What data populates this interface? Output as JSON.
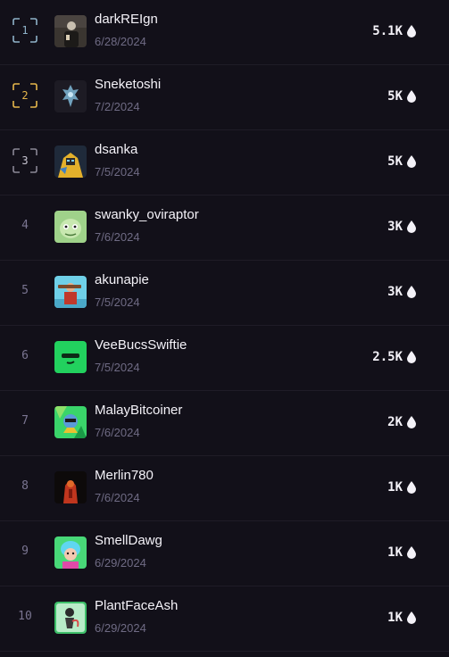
{
  "leaderboard": {
    "rows": [
      {
        "rank": "1",
        "name": "darkREIgn",
        "date": "6/28/2024",
        "amount": "5.1K",
        "icon": "drop-icon"
      },
      {
        "rank": "2",
        "name": "Sneketoshi",
        "date": "7/2/2024",
        "amount": "5K",
        "icon": "drop-icon"
      },
      {
        "rank": "3",
        "name": "dsanka",
        "date": "7/5/2024",
        "amount": "5K",
        "icon": "drop-icon"
      },
      {
        "rank": "4",
        "name": "swanky_oviraptor",
        "date": "7/6/2024",
        "amount": "3K",
        "icon": "drop-icon"
      },
      {
        "rank": "5",
        "name": "akunapie",
        "date": "7/5/2024",
        "amount": "3K",
        "icon": "drop-icon"
      },
      {
        "rank": "6",
        "name": "VeeBucsSwiftie",
        "date": "7/5/2024",
        "amount": "2.5K",
        "icon": "drop-icon"
      },
      {
        "rank": "7",
        "name": "MalayBitcoiner",
        "date": "7/6/2024",
        "amount": "2K",
        "icon": "drop-icon"
      },
      {
        "rank": "8",
        "name": "Merlin780",
        "date": "7/6/2024",
        "amount": "1K",
        "icon": "drop-icon"
      },
      {
        "rank": "9",
        "name": "SmellDawg",
        "date": "6/29/2024",
        "amount": "1K",
        "icon": "drop-icon"
      },
      {
        "rank": "10",
        "name": "PlantFaceAsh",
        "date": "6/29/2024",
        "amount": "1K",
        "icon": "drop-icon"
      }
    ],
    "colors": {
      "background": "#121019",
      "gold": "#e5b64b",
      "silver": "#8fb3c9",
      "bronze": "#8a8796",
      "text": "#f4f2f8",
      "muted": "#6f6b84"
    }
  }
}
